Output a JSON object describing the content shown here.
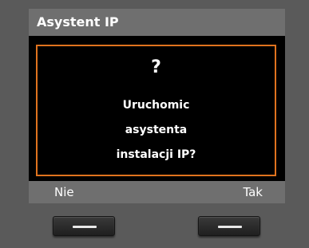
{
  "screen": {
    "title": "Asystent IP",
    "dialog": {
      "symbol": "?",
      "lines": [
        "Uruchomic",
        "asystenta",
        "instalacji IP?"
      ]
    },
    "softkeys": {
      "left": "Nie",
      "right": "Tak"
    }
  },
  "colors": {
    "body_bg": "#5a5a5a",
    "bar_bg": "#6f6f6f",
    "screen_bg": "#000000",
    "dialog_border": "#e0731e",
    "text": "#ffffff"
  },
  "icons": {
    "left_key": "dash-icon",
    "right_key": "dash-icon"
  }
}
